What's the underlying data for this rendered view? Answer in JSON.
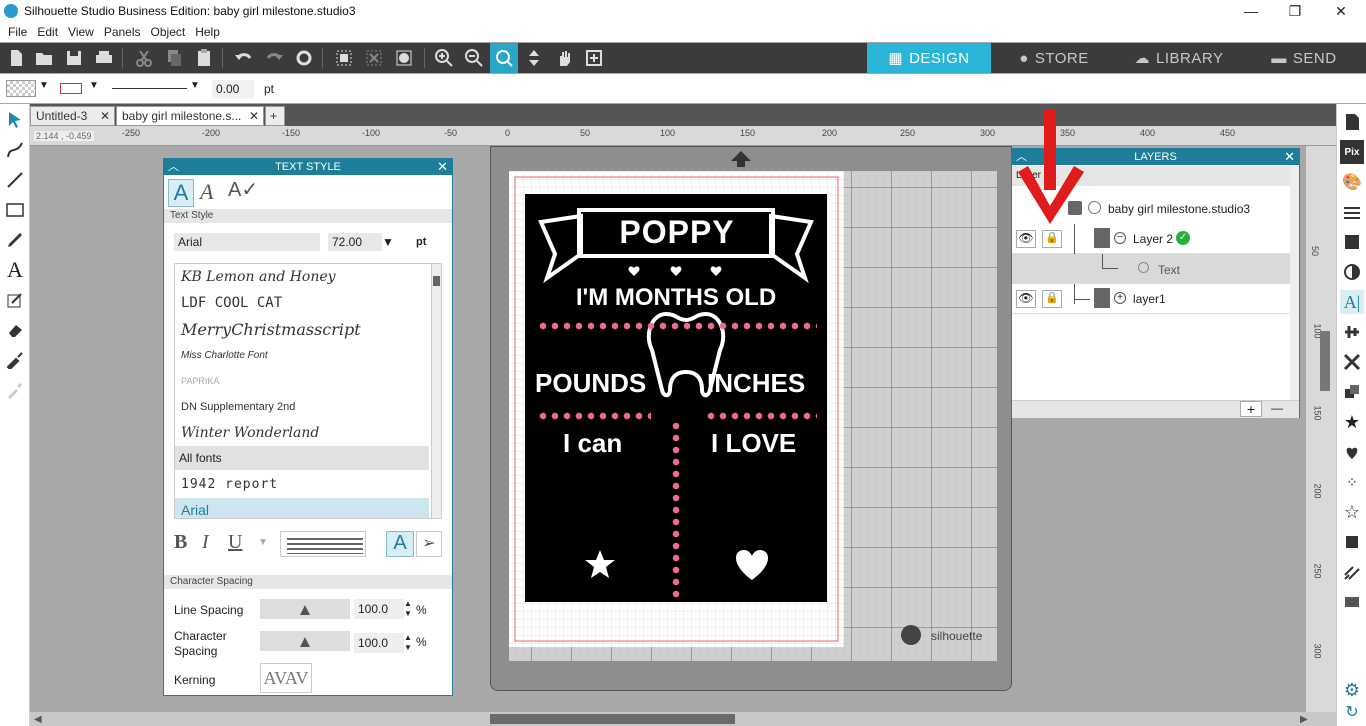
{
  "window": {
    "title": "Silhouette Studio Business Edition: baby girl milestone.studio3",
    "controls": {
      "minimize": "—",
      "maximize": "❐",
      "close": "✕"
    }
  },
  "menu": [
    "File",
    "Edit",
    "View",
    "Panels",
    "Object",
    "Help"
  ],
  "nav_tabs": [
    {
      "label": "DESIGN",
      "selected": true
    },
    {
      "label": "STORE",
      "selected": false
    },
    {
      "label": "LIBRARY",
      "selected": false
    },
    {
      "label": "SEND",
      "selected": false
    }
  ],
  "subbar": {
    "line_width_value": "0.00",
    "line_width_unit": "pt"
  },
  "doc_tabs": [
    {
      "label": "Untitled-3",
      "close": "✕"
    },
    {
      "label": "baby girl milestone.s...",
      "close": "✕"
    }
  ],
  "add_tab": "+",
  "coords": "2.144 , -0.459",
  "ruler_h": [
    "-250",
    "-200",
    "-150",
    "-100",
    "-50",
    "0",
    "50",
    "100",
    "150",
    "200",
    "250",
    "300",
    "350",
    "400",
    "450"
  ],
  "ruler_v": [
    "50",
    "100",
    "150",
    "200",
    "250",
    "300"
  ],
  "text_style": {
    "title": "TEXT STYLE",
    "section_text_style": "Text Style",
    "font_name": "Arial",
    "font_size": "72.00",
    "font_unit": "pt",
    "fonts": [
      "KB Lemon and Honey",
      "LDF COOL CAT",
      "MerryChristmasscript",
      "Miss Charlotte Font",
      "PAPRIKA",
      "DN Supplementary 2nd",
      "Winter Wonderland"
    ],
    "all_fonts_label": "All fonts",
    "font_1942": "1942 report",
    "font_arial": "Arial",
    "section_char_spacing": "Character Spacing",
    "line_spacing_label": "Line Spacing",
    "line_spacing_value": "100.0",
    "char_spacing_label": "Character Spacing",
    "char_spacing_value": "100.0",
    "percent": "%",
    "kerning_label": "Kerning",
    "kerning_sample": "AVAV"
  },
  "design": {
    "name": "POPPY",
    "months": "I'M    MONTHS OLD",
    "pounds": "POUNDS",
    "inches": "INCHES",
    "ican": "I can",
    "ilove": "I LOVE"
  },
  "mat": {
    "brand": "silhouette"
  },
  "layers": {
    "title": "LAYERS",
    "header_text": "Layer",
    "document": "baby girl milestone.studio3",
    "layer2": "Layer 2",
    "text_item": "Text",
    "layer1": "layer1",
    "add": "+",
    "remove": "—"
  }
}
